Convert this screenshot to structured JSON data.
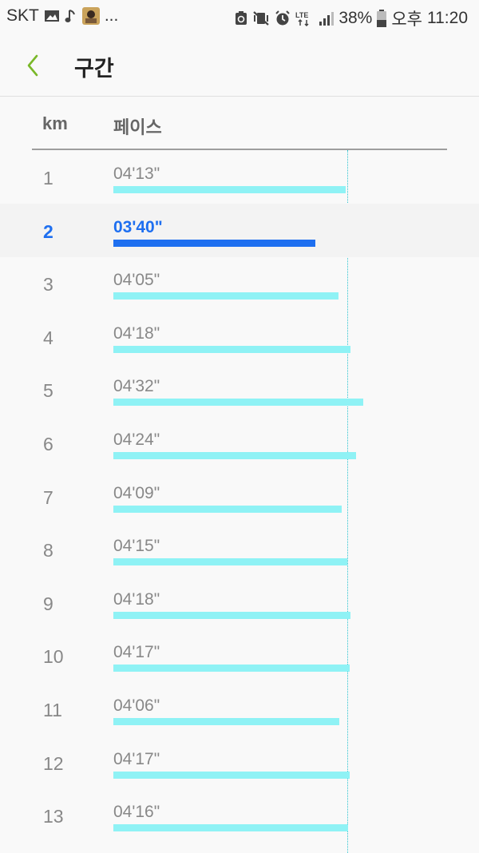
{
  "statusbar": {
    "carrier": "SKT",
    "left_icons": [
      "image-icon",
      "music-note-icon",
      "app-thumbnail-icon"
    ],
    "more": "...",
    "right_icons": [
      "sync-icon",
      "vibrate-mute-icon",
      "alarm-icon",
      "lte-icon",
      "signal-icon"
    ],
    "battery": "38%",
    "ampm": "오후",
    "time": "11:20"
  },
  "appbar": {
    "title": "구간"
  },
  "table": {
    "col_km": "km",
    "col_pace": "페이스",
    "highlight_index": 1,
    "rows": [
      {
        "km": "1",
        "pace": "04'13\"",
        "seconds": 253
      },
      {
        "km": "2",
        "pace": "03'40\"",
        "seconds": 220
      },
      {
        "km": "3",
        "pace": "04'05\"",
        "seconds": 245
      },
      {
        "km": "4",
        "pace": "04'18\"",
        "seconds": 258
      },
      {
        "km": "5",
        "pace": "04'32\"",
        "seconds": 272
      },
      {
        "km": "6",
        "pace": "04'24\"",
        "seconds": 264
      },
      {
        "km": "7",
        "pace": "04'09\"",
        "seconds": 249
      },
      {
        "km": "8",
        "pace": "04'15\"",
        "seconds": 255
      },
      {
        "km": "9",
        "pace": "04'18\"",
        "seconds": 258
      },
      {
        "km": "10",
        "pace": "04'17\"",
        "seconds": 257
      },
      {
        "km": "11",
        "pace": "04'06\"",
        "seconds": 246
      },
      {
        "km": "12",
        "pace": "04'17\"",
        "seconds": 257
      },
      {
        "km": "13",
        "pace": "04'16\"",
        "seconds": 256
      }
    ]
  },
  "colors": {
    "highlight": "#1e6ff0",
    "bar": "#8ff2f5",
    "back_arrow": "#7ab829"
  }
}
